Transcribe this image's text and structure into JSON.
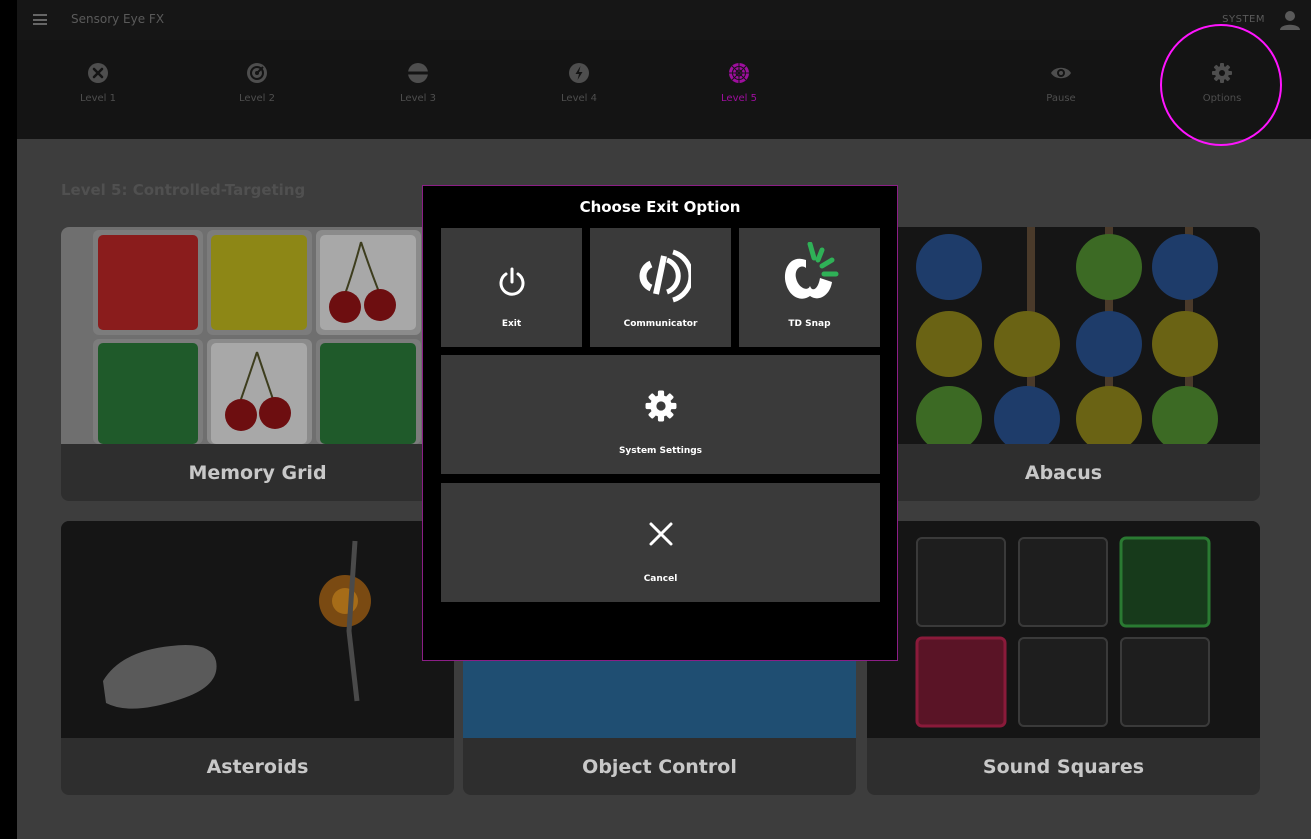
{
  "app": {
    "title": "Sensory Eye FX",
    "user_label": "SYSTEM"
  },
  "nav": {
    "levels": [
      {
        "label": "Level 1",
        "icon": "close-circle-icon"
      },
      {
        "label": "Level 2",
        "icon": "target-circle-icon"
      },
      {
        "label": "Level 3",
        "icon": "split-circle-icon"
      },
      {
        "label": "Level 4",
        "icon": "bolt-circle-icon"
      },
      {
        "label": "Level 5",
        "icon": "web-circle-icon",
        "active": true
      }
    ],
    "pause_label": "Pause",
    "options_label": "Options",
    "active_color": "#9e0e9e",
    "highlight_color": "#ff14ff"
  },
  "section": {
    "title": "Level 5: Controlled-Targeting"
  },
  "cards": [
    {
      "name": "Memory Grid"
    },
    {
      "name": "Abacus"
    },
    {
      "name": "Asteroids"
    },
    {
      "name": "Object Control"
    },
    {
      "name": "Sound Squares"
    }
  ],
  "dialog": {
    "title": "Choose Exit Option",
    "buttons": {
      "exit": "Exit",
      "communicator": "Communicator",
      "td_snap": "TD Snap",
      "system_settings": "System Settings",
      "cancel": "Cancel"
    }
  }
}
